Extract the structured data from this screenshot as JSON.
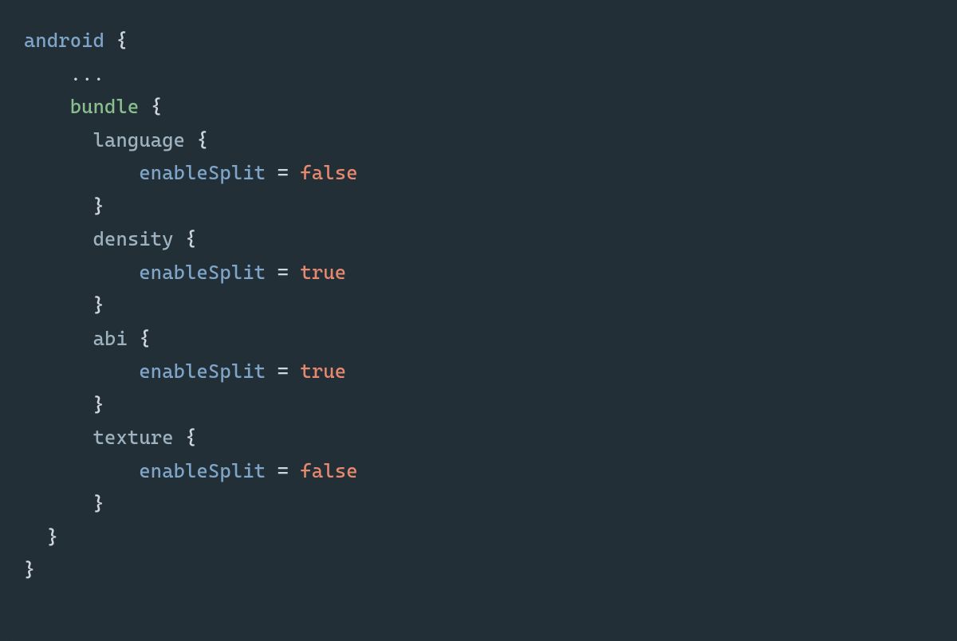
{
  "code": {
    "root": "android",
    "open_brace": "{",
    "close_brace": "}",
    "ellipsis": "...",
    "bundle": {
      "keyword": "bundle",
      "blocks": [
        {
          "name": "language",
          "property": "enableSplit",
          "equals": "=",
          "value": "false"
        },
        {
          "name": "density",
          "property": "enableSplit",
          "equals": "=",
          "value": "true"
        },
        {
          "name": "abi",
          "property": "enableSplit",
          "equals": "=",
          "value": "true"
        },
        {
          "name": "texture",
          "property": "enableSplit",
          "equals": "=",
          "value": "false"
        }
      ]
    }
  }
}
